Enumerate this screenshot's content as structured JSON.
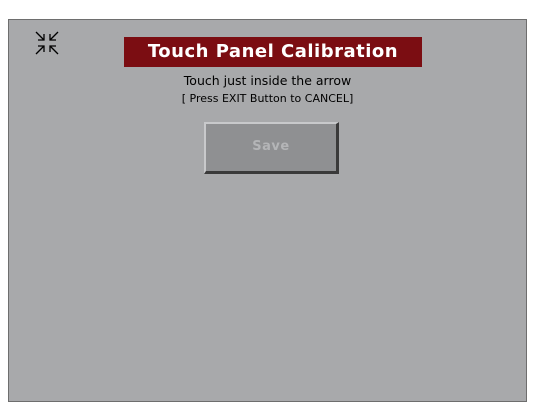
{
  "screen": {
    "title": "Touch Panel Calibration",
    "instruction": "Touch just inside the arrow",
    "cancel_hint": "[ Press EXIT Button to CANCEL]",
    "save_label": "Save",
    "icon": "calibration-arrows-icon"
  },
  "colors": {
    "background": "#a8a9ab",
    "title_bar": "#7b0d12",
    "title_text": "#ffffff",
    "button_face": "#8f9092",
    "button_text_disabled": "#b4b5b7"
  }
}
